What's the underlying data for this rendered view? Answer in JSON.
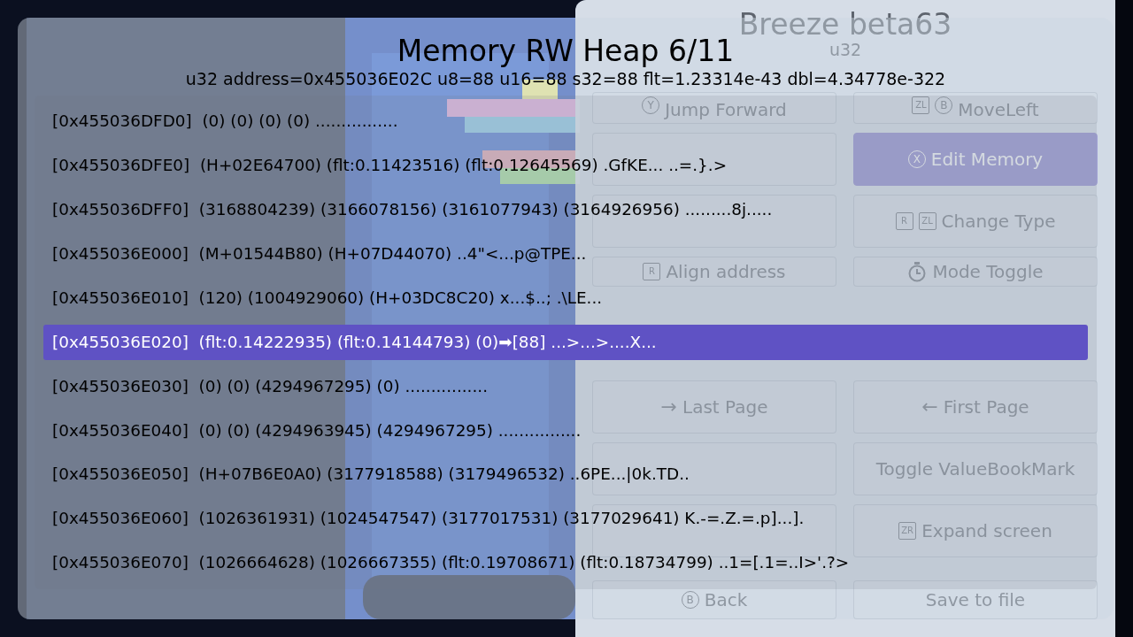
{
  "menu": {
    "title": "Breeze beta63",
    "subtitle": "u32",
    "buttons": [
      {
        "label": "Jump Forward",
        "selected": false,
        "keys": [
          {
            "label": "Y",
            "kind": "circle"
          }
        ]
      },
      {
        "label": "MoveLeft",
        "selected": false,
        "keys": [
          {
            "label": "ZL",
            "kind": "square"
          },
          {
            "label": "B",
            "kind": "circle"
          }
        ]
      },
      {
        "selected": false
      },
      {
        "label": "Edit Memory",
        "selected": true,
        "keys": [
          {
            "label": "X",
            "kind": "circle"
          }
        ]
      },
      {
        "selected": false
      },
      {
        "label": "Change Type",
        "selected": false,
        "keys": [
          {
            "label": "R",
            "kind": "square"
          },
          {
            "label": "ZL",
            "kind": "square"
          }
        ]
      },
      {
        "label": "Align address",
        "selected": false,
        "keys": [
          {
            "label": "R",
            "kind": "square"
          }
        ]
      },
      {
        "label": "Mode Toggle",
        "selected": false,
        "keys": [
          {
            "kind": "stopwatch"
          }
        ]
      },
      {
        "label": "Last Page",
        "selected": false,
        "keys": [
          {
            "label": "→",
            "kind": "plain"
          }
        ]
      },
      {
        "label": "First Page",
        "selected": false,
        "keys": [
          {
            "label": "←",
            "kind": "plain"
          }
        ]
      },
      {
        "selected": false
      },
      {
        "label": "Toggle ValueBookMark",
        "selected": false
      },
      {
        "selected": false
      },
      {
        "label": "Expand screen",
        "selected": false,
        "keys": [
          {
            "label": "ZR",
            "kind": "square"
          }
        ]
      },
      {
        "label": "Back",
        "selected": false,
        "keys": [
          {
            "label": "B",
            "kind": "circle"
          }
        ]
      },
      {
        "label": "Save to file",
        "selected": false
      }
    ]
  },
  "panel": {
    "title": "Memory RW Heap 6/11",
    "info": "u32 address=0x455036E02C u8=88 u16=88 s32=88 flt=1.23314e-43 dbl=4.34778e-322",
    "rows": [
      {
        "address": "[0x455036DFD0]",
        "values": "(0) (0) (0) (0) ................",
        "selected": false
      },
      {
        "address": "[0x455036DFE0]",
        "values": "(H+02E64700) (flt:0.11423516) (flt:0.12645569) .GfKE... ..=.}.>",
        "selected": false
      },
      {
        "address": "[0x455036DFF0]",
        "values": "(3168804239) (3166078156) (3161077943) (3164926956) .........8j.....",
        "selected": false
      },
      {
        "address": "[0x455036E000]",
        "values": "(M+01544B80) (H+07D44070) ..4\"<...p@TPE...",
        "selected": false
      },
      {
        "address": "[0x455036E010]",
        "values": "(120) (1004929060) (H+03DC8C20) x...$..; .\\LE...",
        "selected": false
      },
      {
        "address": "[0x455036E020]",
        "values": "(flt:0.14222935) (flt:0.14144793) (0)➡[88] ...>...>....X...",
        "selected": true
      },
      {
        "address": "[0x455036E030]",
        "values": "(0) (0) (4294967295) (0) ................",
        "selected": false
      },
      {
        "address": "[0x455036E040]",
        "values": "(0) (0) (4294963945) (4294967295) ................",
        "selected": false
      },
      {
        "address": "[0x455036E050]",
        "values": "(H+07B6E0A0) (3177918588) (3179496532) ..6PE...|0k.TD..",
        "selected": false
      },
      {
        "address": "[0x455036E060]",
        "values": "(1026361931) (1024547547) (3177017531) (3177029641) K.-=.Z.=.p]...].",
        "selected": false
      },
      {
        "address": "[0x455036E070]",
        "values": "(1026664628) (1026667355) (flt:0.19708671) (flt:0.18734799) ..1=[.1=..I>'.?>",
        "selected": false
      }
    ]
  }
}
